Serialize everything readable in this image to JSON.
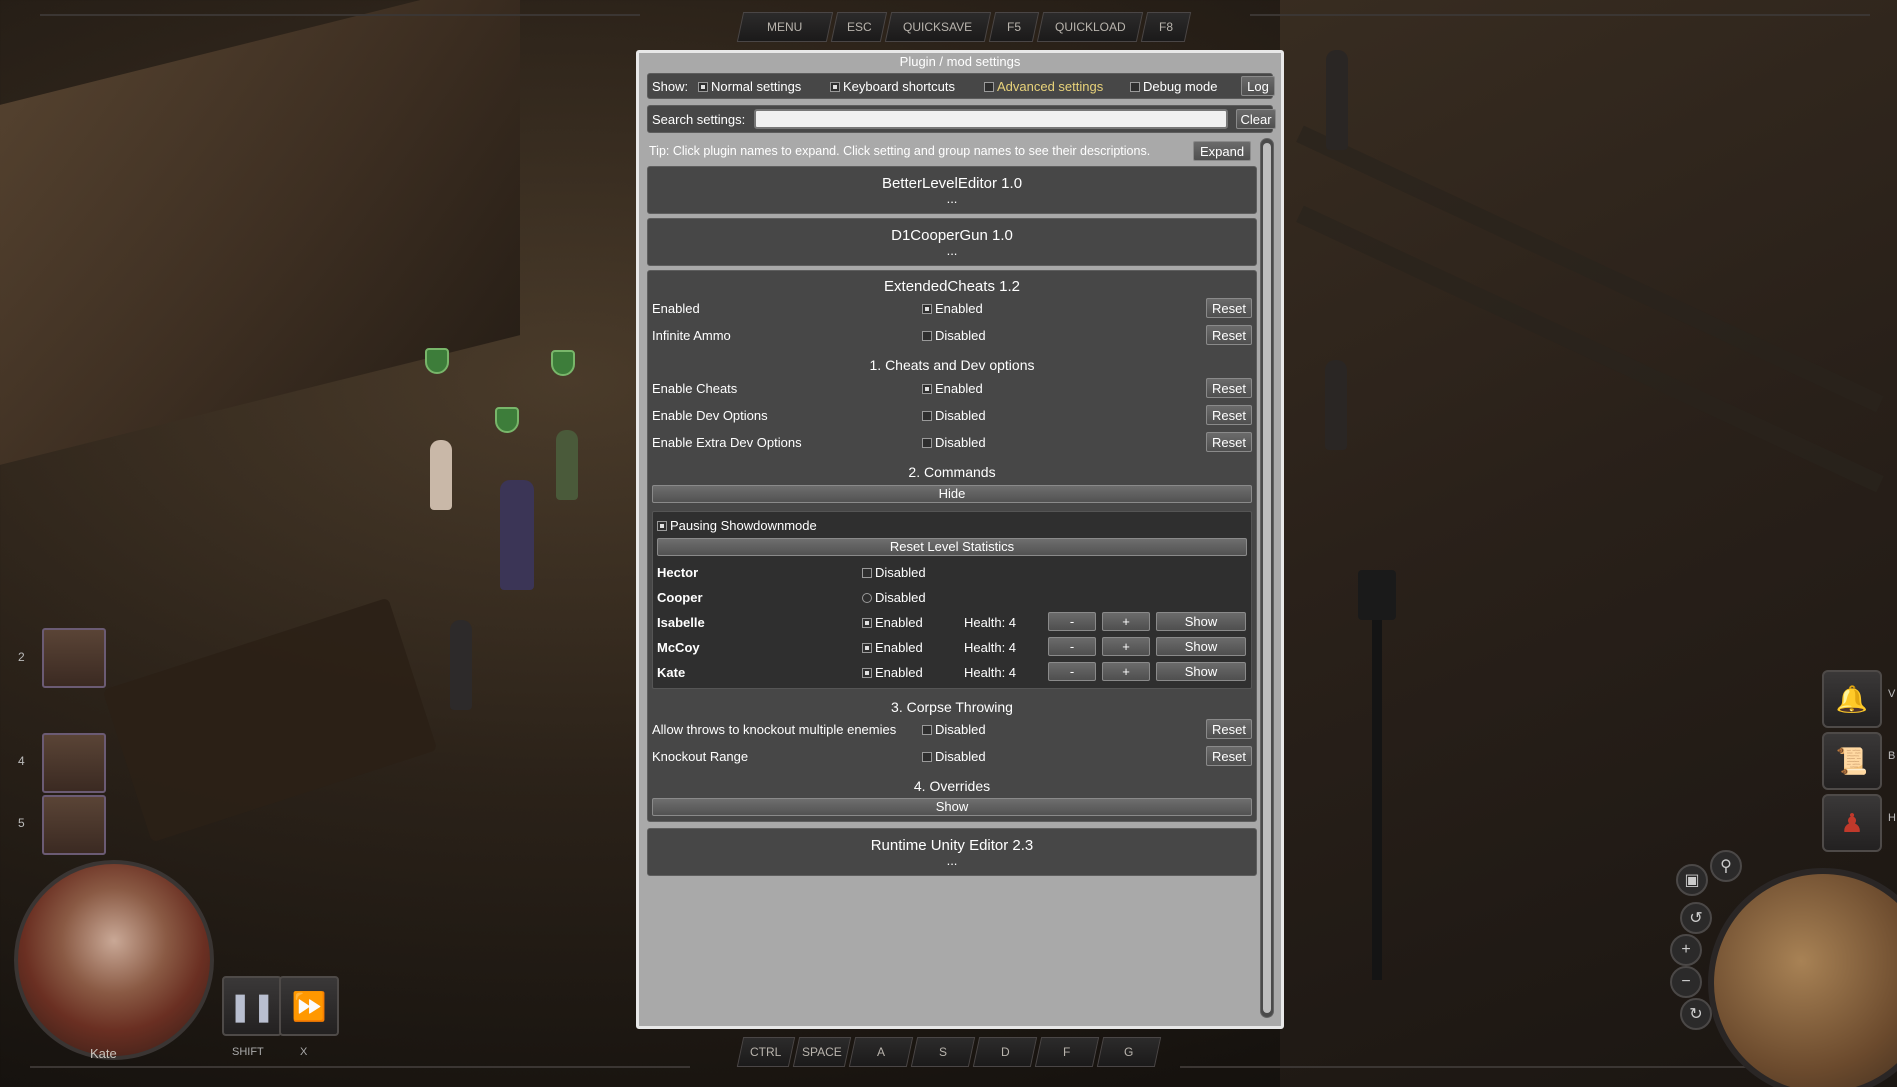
{
  "topbar": {
    "menu": "MENU",
    "esc": "ESC",
    "quicksave": "QUICKSAVE",
    "f5": "F5",
    "quickload": "QUICKLOAD",
    "f8": "F8"
  },
  "bottombar": {
    "keys": [
      "CTRL",
      "SPACE",
      "A",
      "S",
      "D",
      "F",
      "G"
    ]
  },
  "left_panel": {
    "slots": [
      {
        "num": "2"
      },
      {
        "num": "4"
      },
      {
        "num": "5"
      }
    ],
    "active_character": "Kate",
    "pause_key": "SHIFT",
    "fast_forward_key": "X"
  },
  "right_panel": {
    "letters": [
      "V",
      "B",
      "H"
    ]
  },
  "window": {
    "title": "Plugin / mod settings",
    "show_label": "Show:",
    "filters": [
      {
        "label": "Normal settings",
        "checked": true
      },
      {
        "label": "Keyboard shortcuts",
        "checked": true
      },
      {
        "label": "Advanced settings",
        "checked": false,
        "color": "#e8d27a"
      },
      {
        "label": "Debug mode",
        "checked": false
      }
    ],
    "log_button": "Log",
    "search": {
      "label": "Search settings:",
      "value": "",
      "clear_label": "Clear"
    },
    "tip": "Tip: Click plugin names to expand. Click setting and group names to see their descriptions.",
    "expand_label": "Expand",
    "plugins": [
      {
        "name": "BetterLevelEditor 1.0",
        "collapsed": "..."
      },
      {
        "name": "D1CooperGun 1.0",
        "collapsed": "..."
      },
      {
        "name": "ExtendedCheats 1.2"
      },
      {
        "name": "Runtime Unity Editor 2.3",
        "collapsed": "..."
      }
    ],
    "extended_cheats": {
      "top_settings": [
        {
          "name": "Enabled",
          "checked": true,
          "value": "Enabled",
          "reset": "Reset"
        },
        {
          "name": "Infinite Ammo",
          "checked": false,
          "value": "Disabled",
          "reset": "Reset"
        }
      ],
      "group1": {
        "title": "1. Cheats and Dev options",
        "settings": [
          {
            "name": "Enable Cheats",
            "checked": true,
            "value": "Enabled",
            "reset": "Reset"
          },
          {
            "name": "Enable Dev Options",
            "checked": false,
            "value": "Disabled",
            "reset": "Reset"
          },
          {
            "name": "Enable Extra Dev Options",
            "checked": false,
            "value": "Disabled",
            "reset": "Reset"
          }
        ]
      },
      "group2": {
        "title": "2. Commands",
        "hide_label": "Hide",
        "pausing_label": "Pausing Showdownmode",
        "reset_stats_label": "Reset Level Statistics",
        "characters": [
          {
            "name": "Hector",
            "checked": false,
            "value": "Disabled"
          },
          {
            "name": "Cooper",
            "checked": false,
            "value": "Disabled"
          },
          {
            "name": "Isabelle",
            "checked": true,
            "value": "Enabled",
            "health": "Health: 4",
            "minus": "-",
            "plus": "+",
            "show": "Show"
          },
          {
            "name": "McCoy",
            "checked": true,
            "value": "Enabled",
            "health": "Health: 4",
            "minus": "-",
            "plus": "+",
            "show": "Show"
          },
          {
            "name": "Kate",
            "checked": true,
            "value": "Enabled",
            "health": "Health: 4",
            "minus": "-",
            "plus": "+",
            "show": "Show"
          }
        ]
      },
      "group3": {
        "title": "3. Corpse Throwing",
        "settings": [
          {
            "name": "Allow throws to knockout multiple enemies",
            "checked": false,
            "value": "Disabled",
            "reset": "Reset"
          },
          {
            "name": "Knockout Range",
            "checked": false,
            "value": "Disabled",
            "reset": "Reset"
          }
        ]
      },
      "group4": {
        "title": "4. Overrides",
        "show_label": "Show"
      }
    }
  }
}
